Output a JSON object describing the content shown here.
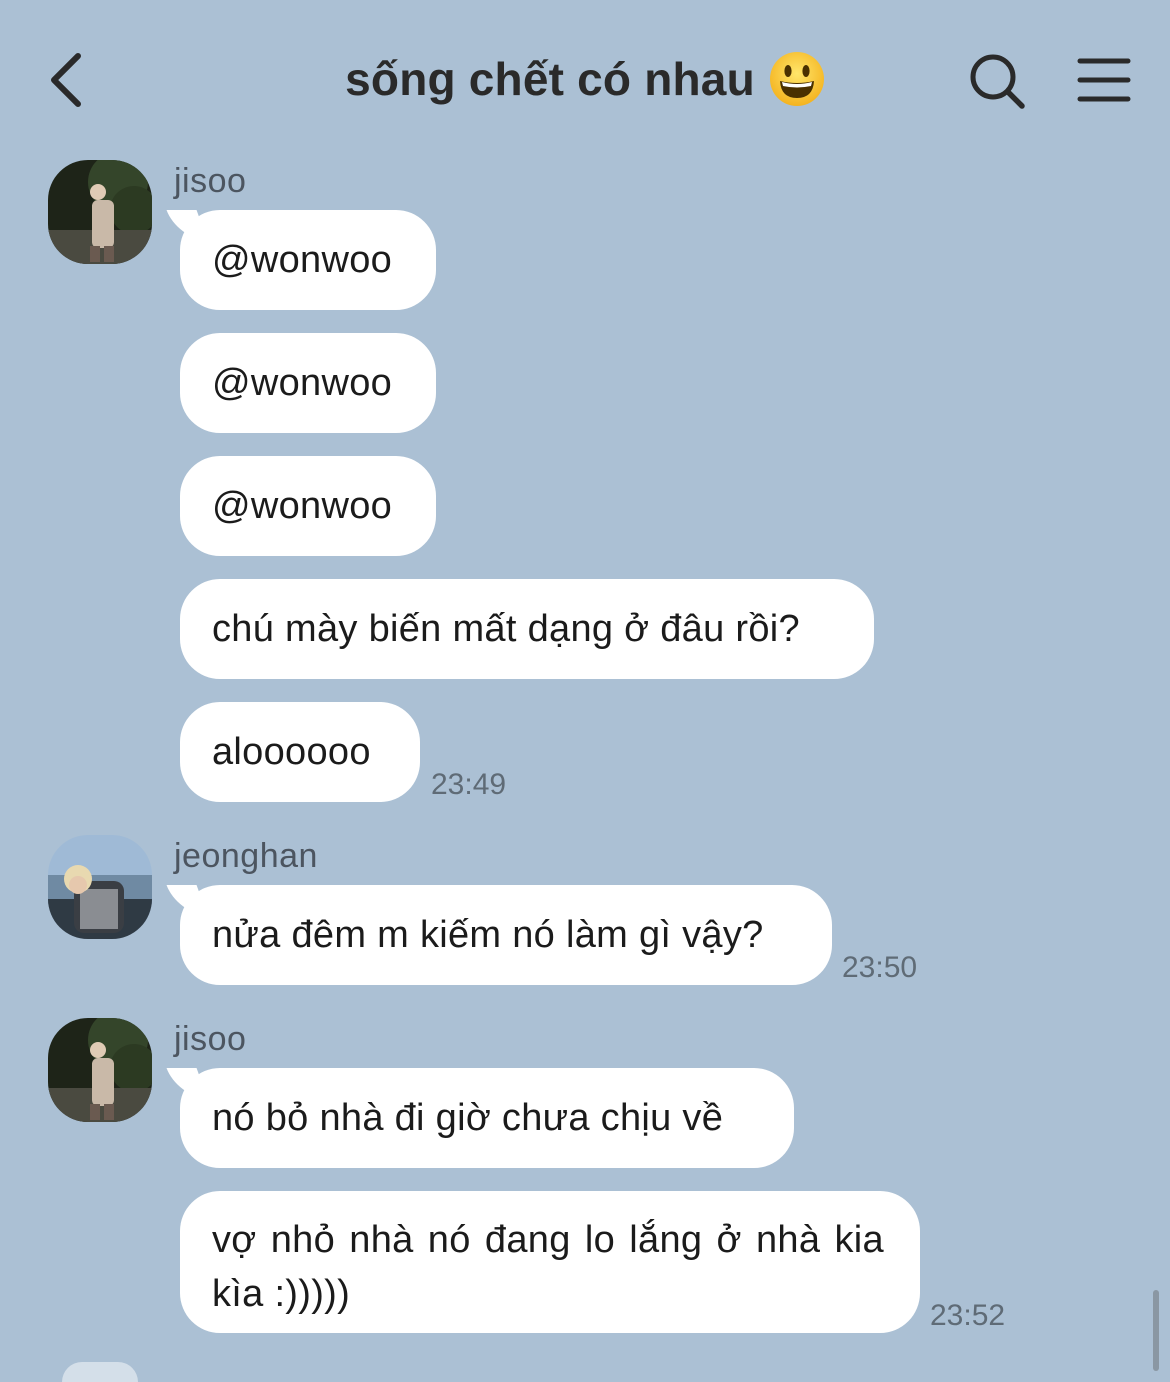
{
  "header": {
    "title": "sống chết có nhau",
    "title_emoji": "grinning-face-emoji",
    "back_icon": "chevron-left-icon",
    "search_icon": "search-icon",
    "menu_icon": "menu-icon"
  },
  "colors": {
    "background": "#abc0d4",
    "bubble": "#ffffff",
    "text": "#1b1b1b",
    "meta": "#5f6b76"
  },
  "messages": [
    {
      "sender": "jisoo",
      "bubbles": [
        "@wonwoo",
        "@wonwoo",
        "@wonwoo",
        "chú mày biến mất dạng ở đâu rồi?",
        "aloooooo"
      ],
      "time": "23:49"
    },
    {
      "sender": "jeonghan",
      "bubbles": [
        "nửa đêm m kiếm nó làm gì vậy?"
      ],
      "time": "23:50"
    },
    {
      "sender": "jisoo",
      "bubbles": [
        "nó bỏ nhà đi giờ chưa chịu về",
        "vợ nhỏ nhà nó đang lo lắng ở nhà kia kìa :)))))"
      ],
      "time": "23:52"
    }
  ]
}
